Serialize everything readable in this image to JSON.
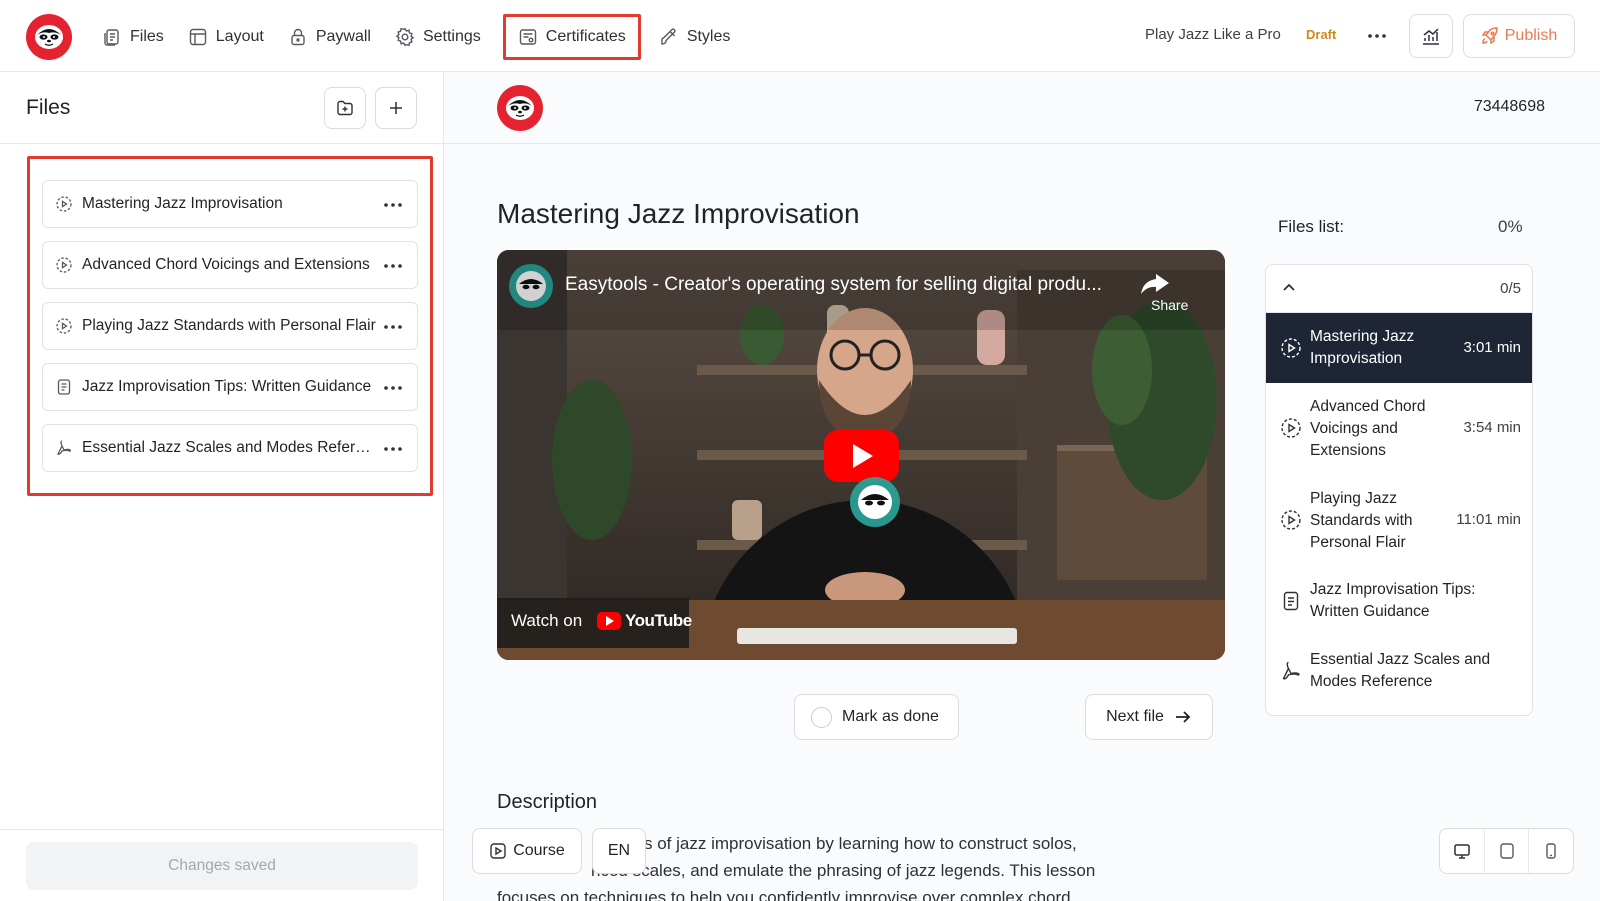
{
  "nav": {
    "items": [
      {
        "label": "Files",
        "icon": "files-icon"
      },
      {
        "label": "Layout",
        "icon": "layout-icon"
      },
      {
        "label": "Paywall",
        "icon": "lock-icon"
      },
      {
        "label": "Settings",
        "icon": "gear-icon"
      },
      {
        "label": "Certificates",
        "icon": "certificate-icon"
      },
      {
        "label": "Styles",
        "icon": "brush-icon"
      }
    ],
    "active": "Certificates",
    "course_title": "Play Jazz Like a Pro",
    "status": "Draft",
    "publish_label": "Publish"
  },
  "sidebar": {
    "title": "Files",
    "files": [
      {
        "name": "Mastering Jazz Improvisation",
        "type": "video"
      },
      {
        "name": "Advanced Chord Voicings and Extensions",
        "type": "video"
      },
      {
        "name": "Playing Jazz Standards with Personal Flair",
        "type": "video"
      },
      {
        "name": "Jazz Improvisation Tips: Written Guidance",
        "type": "document"
      },
      {
        "name": "Essential Jazz Scales and Modes Reference",
        "type": "pdf"
      }
    ],
    "save_status": "Changes saved"
  },
  "main": {
    "course_id": "73448698",
    "lesson_title": "Mastering Jazz Improvisation",
    "video": {
      "title": "Easytools - Creator's operating system for selling digital produ...",
      "share_label": "Share",
      "watch_on": "Watch on",
      "platform": "YouTube"
    },
    "mark_done_label": "Mark as done",
    "next_file_label": "Next file",
    "description_heading": "Description",
    "description_lines": [
      "s of jazz improvisation by learning how to construct solos,",
      "nced scales, and emulate the phrasing of jazz legends. This lesson",
      "focuses on techniques to help you confidently improvise over complex chord"
    ],
    "course_pill": "Course",
    "lang_pill": "EN"
  },
  "files_list": {
    "label": "Files list:",
    "progress": "0%",
    "count": "0/5",
    "items": [
      {
        "name": "Mastering Jazz Improvisation",
        "duration": "3:01 min",
        "type": "video",
        "active": true
      },
      {
        "name": "Advanced Chord Voicings and Extensions",
        "duration": "3:54 min",
        "type": "video"
      },
      {
        "name": "Playing Jazz Standards with Personal Flair",
        "duration": "11:01 min",
        "type": "video"
      },
      {
        "name": "Jazz Improvisation Tips: Written Guidance",
        "duration": "",
        "type": "document"
      },
      {
        "name": "Essential Jazz Scales and Modes Reference",
        "duration": "",
        "type": "pdf"
      }
    ]
  },
  "colors": {
    "brand": "#e5222f",
    "highlight": "#e03b2f",
    "draft": "#d28a18",
    "publish": "#e97b4f",
    "active_item": "#1e2636"
  }
}
